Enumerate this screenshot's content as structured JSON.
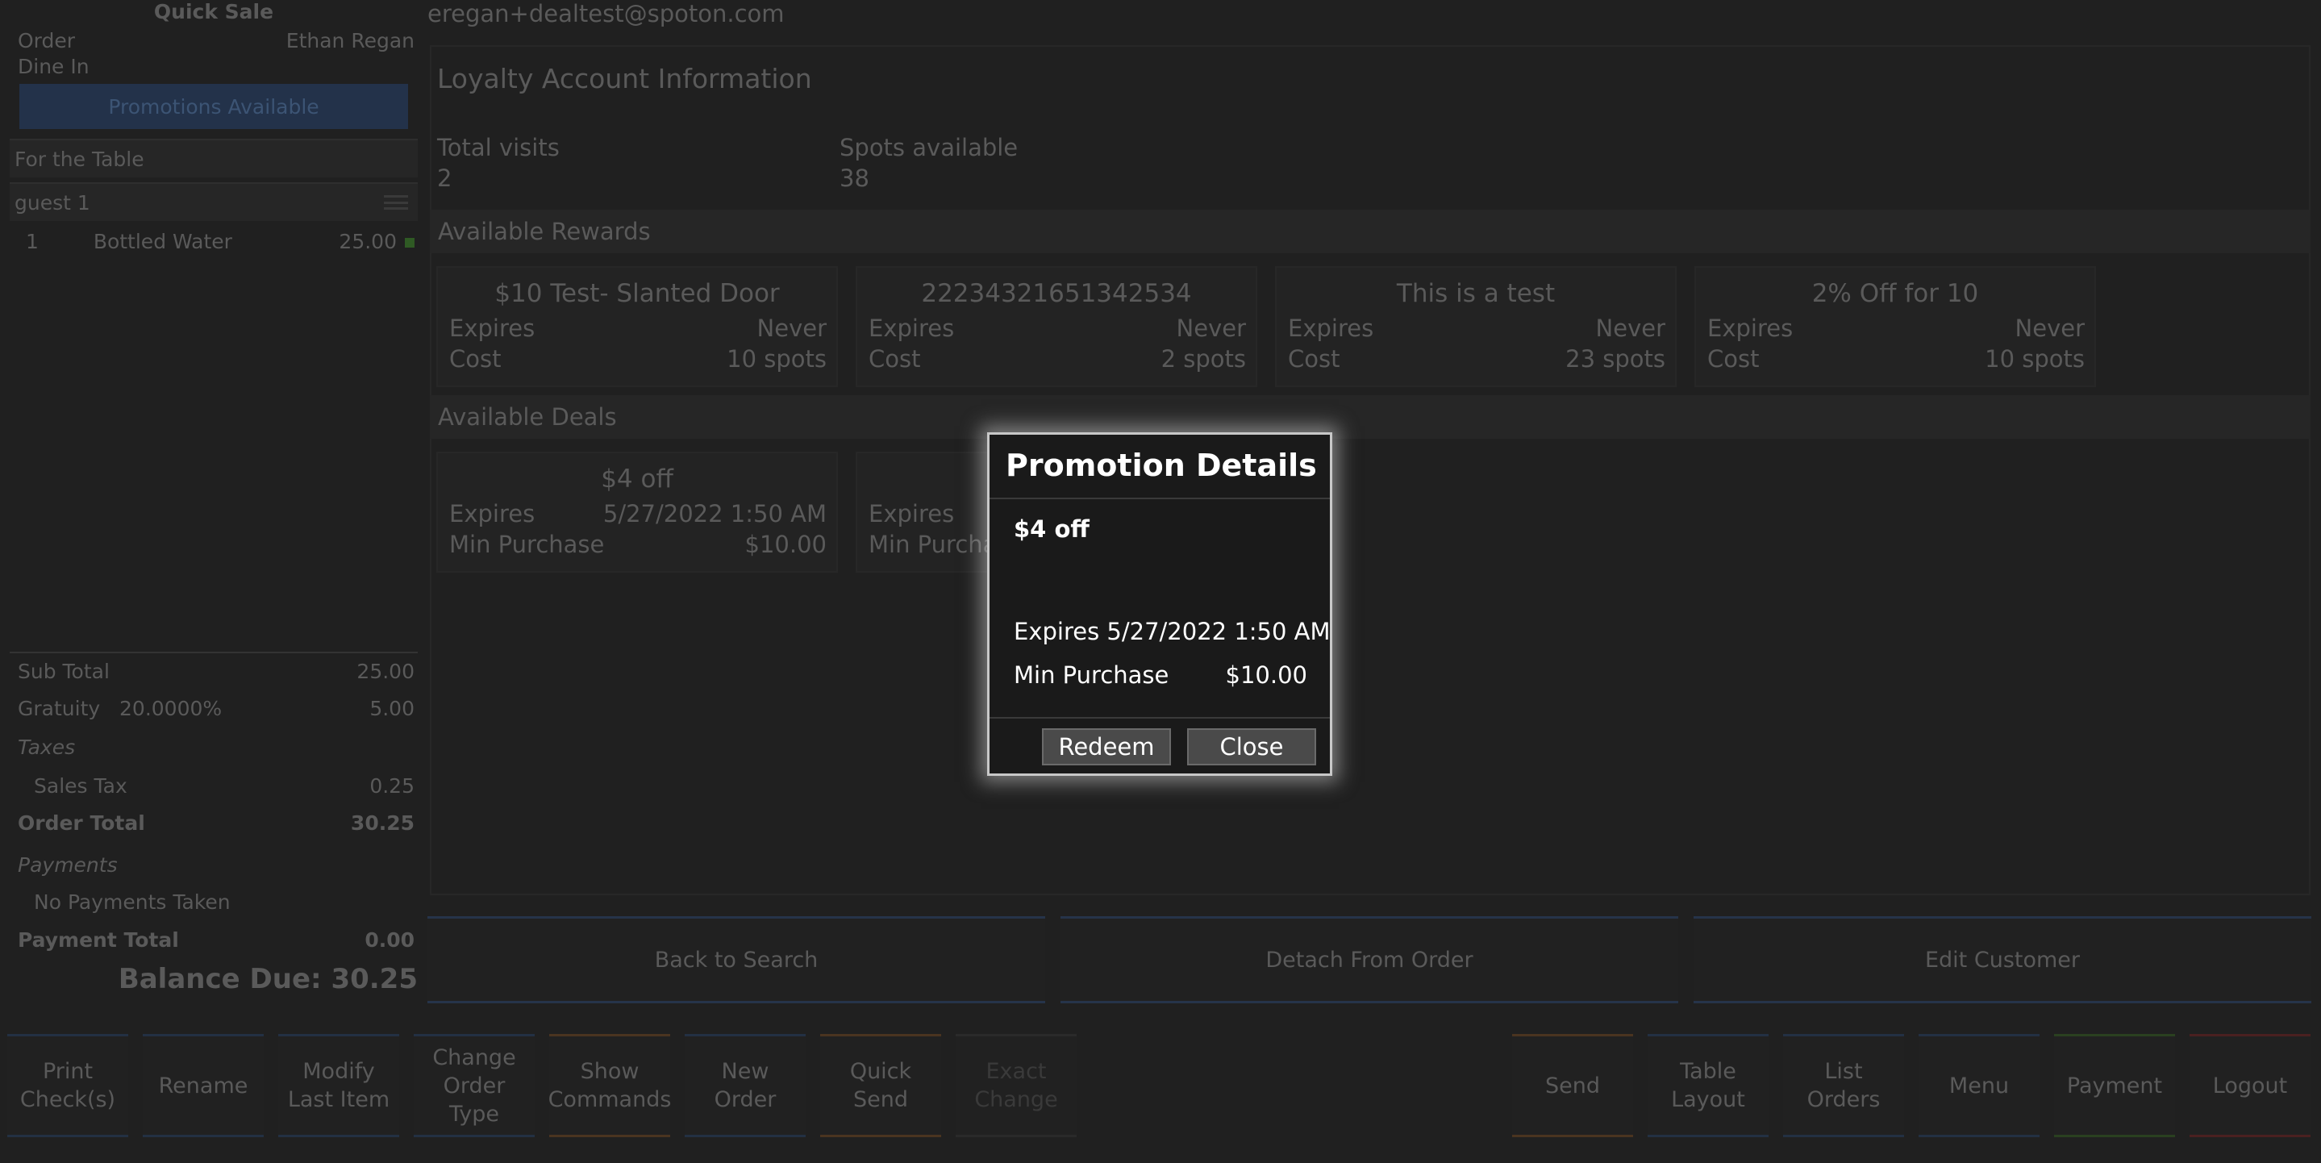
{
  "order_panel": {
    "title": "Quick Sale",
    "order_label": "Order",
    "server_name": "Ethan Regan",
    "order_type": "Dine In",
    "promotions_button": "Promotions Available",
    "section_label": "For the Table",
    "guest_label": "guest 1",
    "items": [
      {
        "qty": "1",
        "name": "Bottled Water",
        "price": "25.00"
      }
    ],
    "totals": {
      "subtotal_label": "Sub Total",
      "subtotal": "25.00",
      "gratuity_label": "Gratuity",
      "gratuity_rate": "20.0000%",
      "gratuity": "5.00",
      "taxes_label": "Taxes",
      "sales_tax_label": "Sales Tax",
      "sales_tax": "0.25",
      "order_total_label": "Order Total",
      "order_total": "30.25",
      "payments_label": "Payments",
      "no_payments": "No Payments Taken",
      "payment_total_label": "Payment Total",
      "payment_total": "0.00",
      "balance_due": "Balance Due: 30.25"
    }
  },
  "loyalty": {
    "customer_email": "eregan+dealtest@spoton.com",
    "title": "Loyalty Account Information",
    "total_visits_label": "Total visits",
    "total_visits": "2",
    "spots_available_label": "Spots available",
    "spots_available": "38",
    "rewards_header": "Available Rewards",
    "rewards": [
      {
        "title": "$10 Test- Slanted Door",
        "expires_label": "Expires",
        "expires": "Never",
        "cost_label": "Cost",
        "cost": "10 spots"
      },
      {
        "title": "22234321651342534",
        "expires_label": "Expires",
        "expires": "Never",
        "cost_label": "Cost",
        "cost": "2 spots"
      },
      {
        "title": "This is a test",
        "expires_label": "Expires",
        "expires": "Never",
        "cost_label": "Cost",
        "cost": "23 spots"
      },
      {
        "title": "2% Off for 10",
        "expires_label": "Expires",
        "expires": "Never",
        "cost_label": "Cost",
        "cost": "10 spots"
      }
    ],
    "deals_header": "Available Deals",
    "deals": [
      {
        "title": "$4 off",
        "expires_label": "Expires",
        "expires": "5/27/2022 1:50 AM",
        "min_label": "Min Purchase",
        "min": "$10.00"
      },
      {
        "expires_label": "Expires",
        "min_label": "Min Purcha"
      }
    ],
    "actions": {
      "back": "Back to Search",
      "detach": "Detach From Order",
      "edit": "Edit Customer"
    }
  },
  "toolbar": [
    "Print\nCheck(s)",
    "Rename",
    "Modify\nLast Item",
    "Change\nOrder\nType",
    "Show\nCommands",
    "New\nOrder",
    "Quick\nSend",
    "Exact\nChange",
    "Send",
    "Table\nLayout",
    "List\nOrders",
    "Menu",
    "Payment",
    "Logout"
  ],
  "modal": {
    "title": "Promotion Details",
    "promo_name": "$4 off",
    "expires_text": "Expires 5/27/2022 1:50 AM",
    "min_purchase_label": "Min Purchase",
    "min_purchase_value": "$10.00",
    "redeem_label": "Redeem",
    "close_label": "Close"
  }
}
